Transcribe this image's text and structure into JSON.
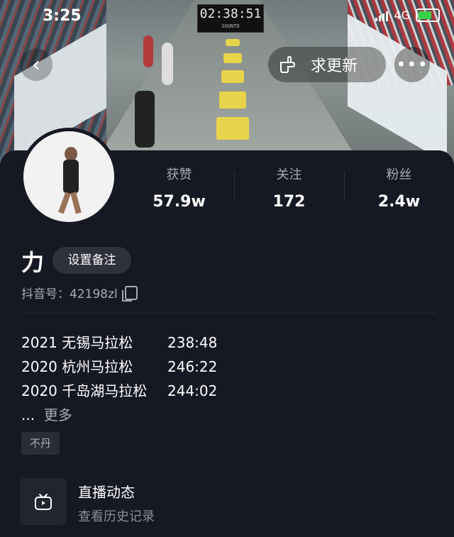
{
  "status_bar": {
    "time": "3:25",
    "network": "4G"
  },
  "cover": {
    "race_clock": "02:38:51",
    "clock_brand": "SUUNTO"
  },
  "header": {
    "back_icon": "chevron-left-icon",
    "update_label": "求更新",
    "update_icon": "pointing-hand-icon",
    "more_icon": "more-dots-icon"
  },
  "profile": {
    "name": "力",
    "remark_button": "设置备注",
    "douyin_id_label": "抖音号：",
    "douyin_id": "42198zl",
    "stats": [
      {
        "label": "获赞",
        "value": "57.9w"
      },
      {
        "label": "关注",
        "value": "172"
      },
      {
        "label": "粉丝",
        "value": "2.4w"
      }
    ]
  },
  "bio": {
    "lines": [
      {
        "race": "2021 无锡马拉松",
        "time": "238:48"
      },
      {
        "race": "2020 杭州马拉松",
        "time": "246:22"
      },
      {
        "race": "2020 千岛湖马拉松",
        "time": "244:02"
      }
    ],
    "ellipsis": "...",
    "more_label": "更多"
  },
  "tags": [
    "不丹"
  ],
  "live_card": {
    "title": "直播动态",
    "subtitle": "查看历史记录",
    "icon": "tv-icon"
  },
  "colors": {
    "background": "#161823",
    "muted_text": "#a9abb3",
    "chip_bg": "#2f313c"
  }
}
